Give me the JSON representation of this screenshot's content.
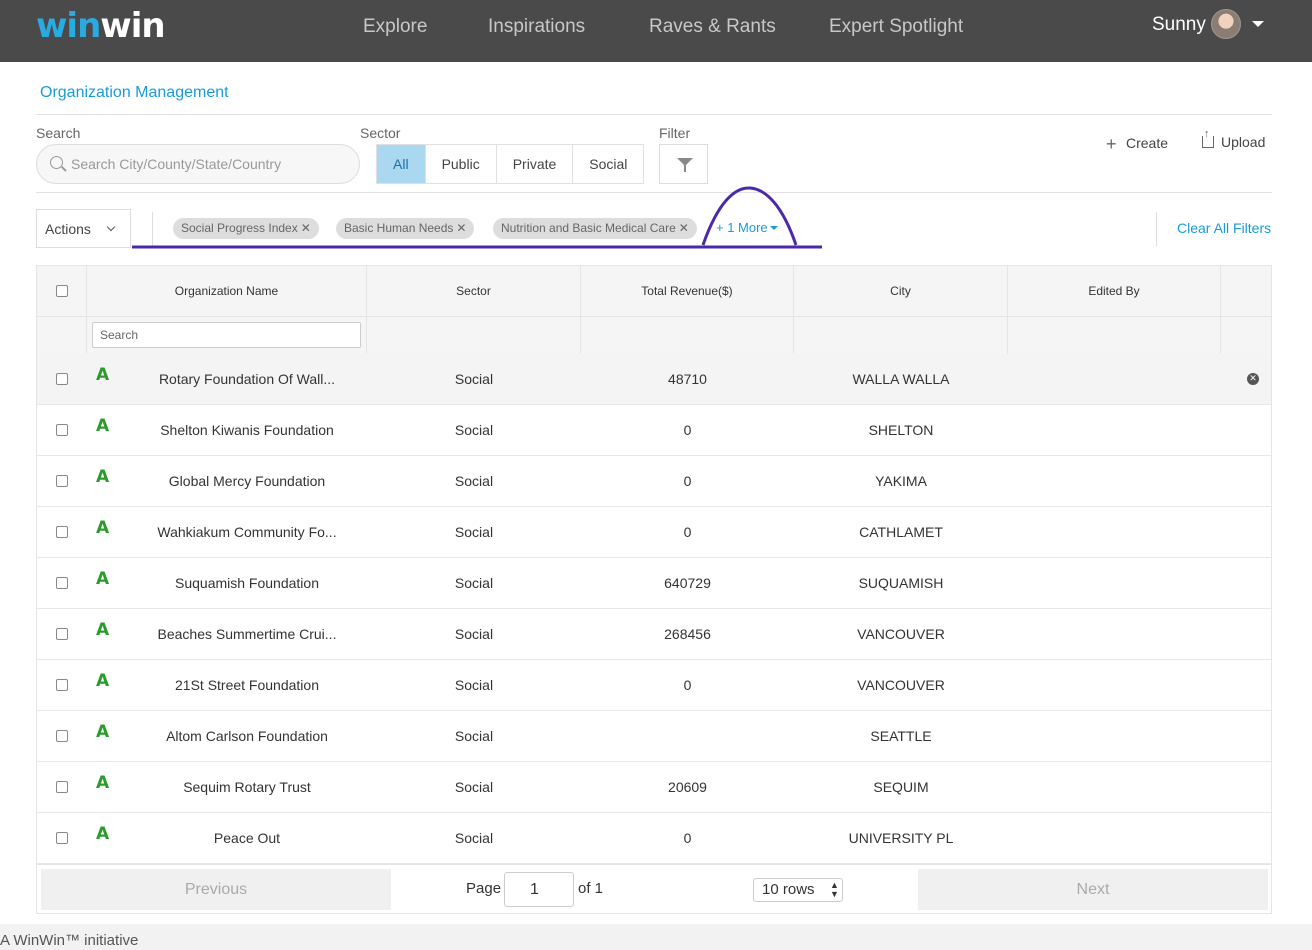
{
  "header": {
    "logo_part1": "win",
    "logo_part2": "win",
    "nav": [
      "Explore",
      "Inspirations",
      "Raves & Rants",
      "Expert Spotlight"
    ],
    "user_name": "Sunny"
  },
  "page": {
    "title": "Organization Management",
    "search_label": "Search",
    "search_placeholder": "Search City/County/State/Country",
    "sector_label": "Sector",
    "sectors": [
      "All",
      "Public",
      "Private",
      "Social"
    ],
    "active_sector": "All",
    "filter_label": "Filter",
    "create_label": "Create",
    "upload_label": "Upload"
  },
  "filters": {
    "actions_label": "Actions",
    "chips": [
      "Social Progress Index",
      "Basic Human Needs",
      "Nutrition and Basic Medical Care"
    ],
    "more_label": "+ 1 More",
    "clear_all_label": "Clear All Filters"
  },
  "table": {
    "columns": [
      "Organization Name",
      "Sector",
      "Total Revenue($)",
      "City",
      "Edited By"
    ],
    "search_placeholder": "Search",
    "rows": [
      {
        "grade": "A",
        "name": "Rotary Foundation Of Wall...",
        "sector": "Social",
        "revenue": "48710",
        "city": "WALLA WALLA",
        "edited_by": ""
      },
      {
        "grade": "A",
        "name": "Shelton Kiwanis Foundation",
        "sector": "Social",
        "revenue": "0",
        "city": "SHELTON",
        "edited_by": ""
      },
      {
        "grade": "A",
        "name": "Global Mercy Foundation",
        "sector": "Social",
        "revenue": "0",
        "city": "YAKIMA",
        "edited_by": ""
      },
      {
        "grade": "A",
        "name": "Wahkiakum Community Fo...",
        "sector": "Social",
        "revenue": "0",
        "city": "CATHLAMET",
        "edited_by": ""
      },
      {
        "grade": "A",
        "name": "Suquamish Foundation",
        "sector": "Social",
        "revenue": "640729",
        "city": "SUQUAMISH",
        "edited_by": ""
      },
      {
        "grade": "A",
        "name": "Beaches Summertime Crui...",
        "sector": "Social",
        "revenue": "268456",
        "city": "VANCOUVER",
        "edited_by": ""
      },
      {
        "grade": "A",
        "name": "21St Street Foundation",
        "sector": "Social",
        "revenue": "0",
        "city": "VANCOUVER",
        "edited_by": ""
      },
      {
        "grade": "A",
        "name": "Altom Carlson Foundation",
        "sector": "Social",
        "revenue": "",
        "city": "SEATTLE",
        "edited_by": ""
      },
      {
        "grade": "A",
        "name": "Sequim Rotary Trust",
        "sector": "Social",
        "revenue": "20609",
        "city": "SEQUIM",
        "edited_by": ""
      },
      {
        "grade": "A",
        "name": "Peace Out",
        "sector": "Social",
        "revenue": "0",
        "city": "UNIVERSITY PL",
        "edited_by": ""
      }
    ]
  },
  "pagination": {
    "previous_label": "Previous",
    "next_label": "Next",
    "page_label": "Page",
    "current_page": "1",
    "of_label": "of 1",
    "rows_label": "10 rows"
  },
  "footer": {
    "text": "A WinWin™ initiative"
  },
  "colors": {
    "accent": "#1a9bd7",
    "header_bg": "#4a4a4a",
    "grade_green": "#2b9b2b",
    "annotation_purple": "#4b2aa8"
  }
}
